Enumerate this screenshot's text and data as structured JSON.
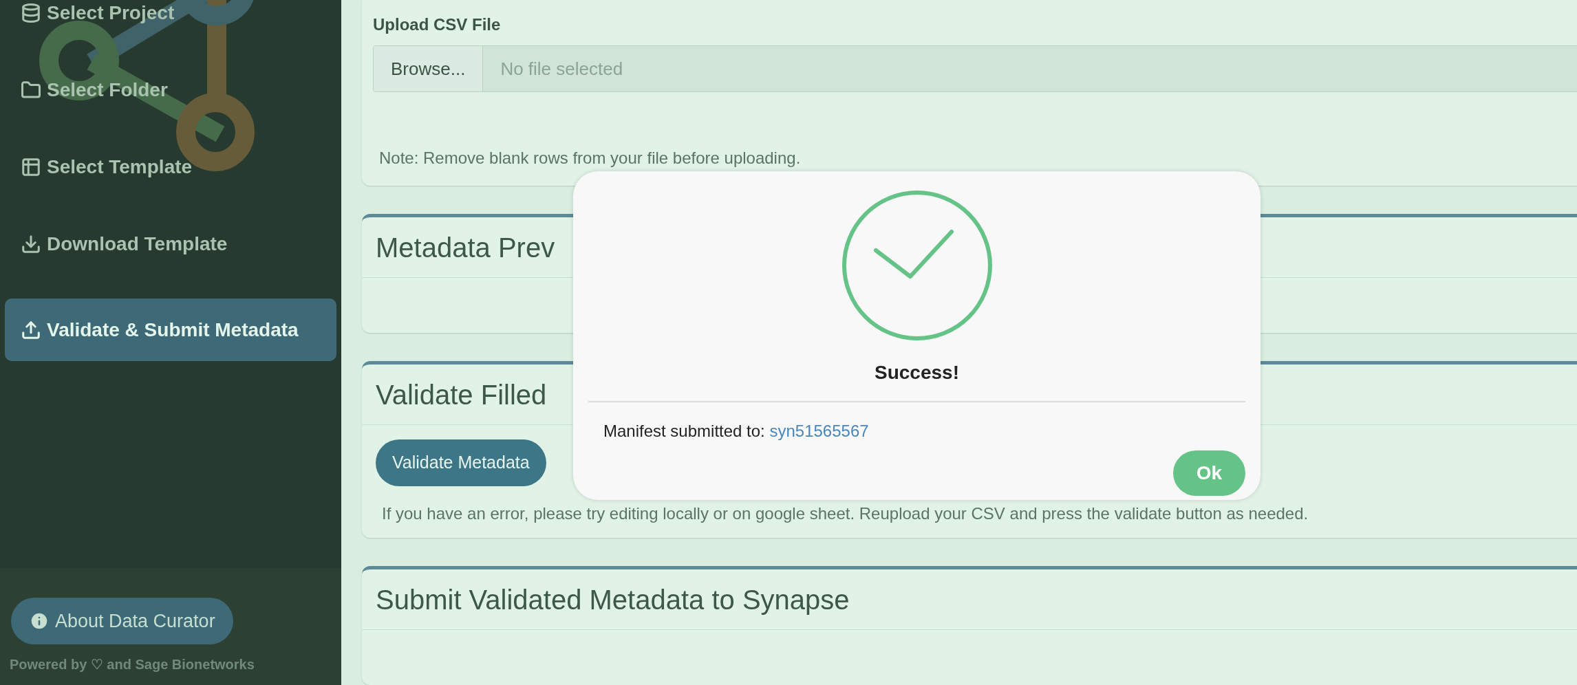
{
  "sidebar": {
    "items": [
      {
        "label": "Select Project",
        "selected": false
      },
      {
        "label": "Select Folder",
        "selected": false
      },
      {
        "label": "Select Template",
        "selected": false
      },
      {
        "label": "Download Template",
        "selected": false
      },
      {
        "label": "Validate & Submit Metadata",
        "selected": true
      }
    ],
    "about_button": "About Data Curator",
    "footer": "Powered by ♡ and Sage Bionetworks"
  },
  "upload": {
    "label": "Upload CSV File",
    "browse_button": "Browse...",
    "file_field": {
      "placeholder": "No file selected"
    },
    "note": "Note: Remove blank rows from your file before uploading."
  },
  "sections": [
    {
      "title": "Metadata Prev"
    },
    {
      "title": "Validate Filled",
      "button": "Validate Metadata",
      "help": "If you have an error, please try editing locally or on google sheet. Reupload your CSV and press the validate button as needed."
    },
    {
      "title": "Submit Validated Metadata to Synapse"
    }
  ],
  "dialog": {
    "title": "Success!",
    "message": "Manifest submitted to:",
    "link": "syn51565567",
    "ok_button": "Ok"
  }
}
